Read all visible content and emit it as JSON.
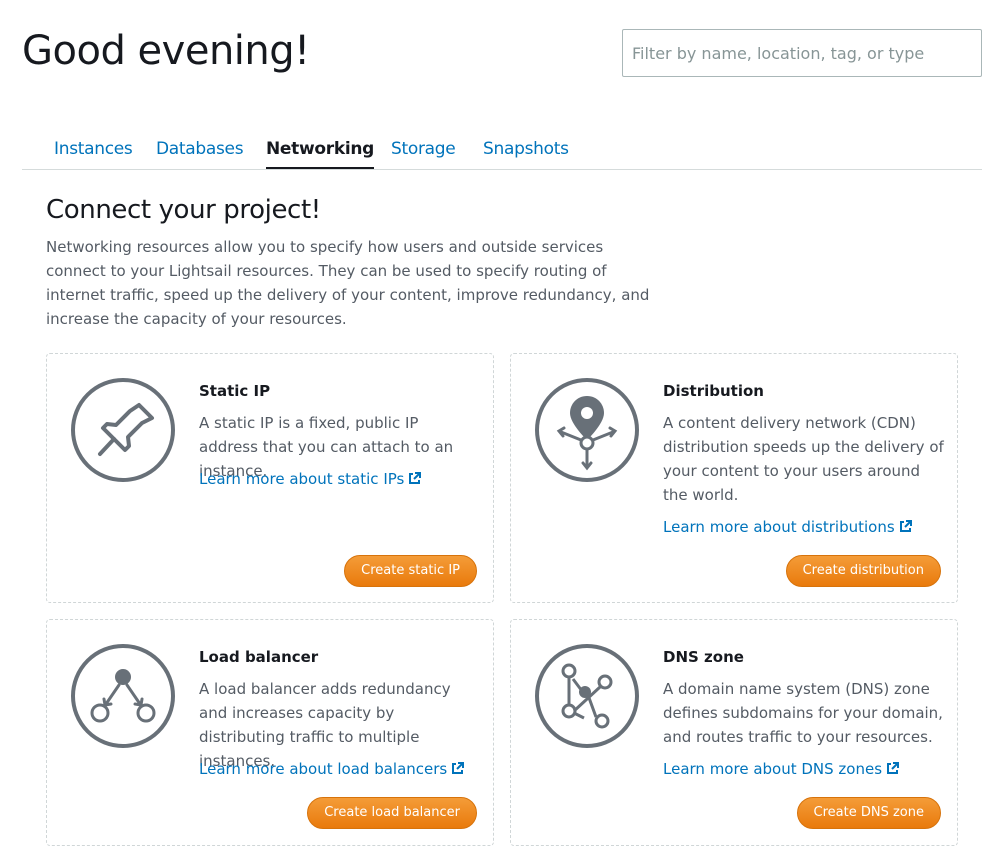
{
  "header": {
    "greeting": "Good evening!",
    "search_placeholder": "Filter by name, location, tag, or type",
    "search_value": ""
  },
  "tabs": [
    {
      "label": "Instances",
      "active": false
    },
    {
      "label": "Databases",
      "active": false
    },
    {
      "label": "Networking",
      "active": true
    },
    {
      "label": "Storage",
      "active": false
    },
    {
      "label": "Snapshots",
      "active": false
    }
  ],
  "main": {
    "title": "Connect your project!",
    "intro": "Networking resources allow you to specify how users and outside services connect to your Lightsail resources. They can be used to specify routing of internet traffic, speed up the delivery of your content, improve redundancy, and increase the capacity of your resources."
  },
  "cards": {
    "static_ip": {
      "icon": "pushpin-icon",
      "title": "Static IP",
      "description": "A static IP is a fixed, public IP address that you can attach to an instance.",
      "link": "Learn more about static IPs",
      "button": "Create static IP"
    },
    "distribution": {
      "icon": "location-pin-icon",
      "title": "Distribution",
      "description": "A content delivery network (CDN) distribution speeds up the delivery of your content to your users around the world.",
      "link": "Learn more about distributions",
      "button": "Create distribution"
    },
    "load_balancer": {
      "icon": "load-balancer-icon",
      "title": "Load balancer",
      "description": "A load balancer adds redundancy and increases capacity by distributing traffic to multiple instances.",
      "link": "Learn more about load balancers",
      "button": "Create load balancer"
    },
    "dns_zone": {
      "icon": "dns-graph-icon",
      "title": "DNS zone",
      "description": "A domain name system (DNS) zone defines subdomains for your domain, and routes traffic to your resources.",
      "link": "Learn more about DNS zones",
      "button": "Create DNS zone"
    }
  },
  "colors": {
    "link": "#0073bb",
    "button_orange": "#ec7211",
    "icon_gray": "#687078",
    "text_dark": "#16191f",
    "text_muted": "#545b64"
  }
}
